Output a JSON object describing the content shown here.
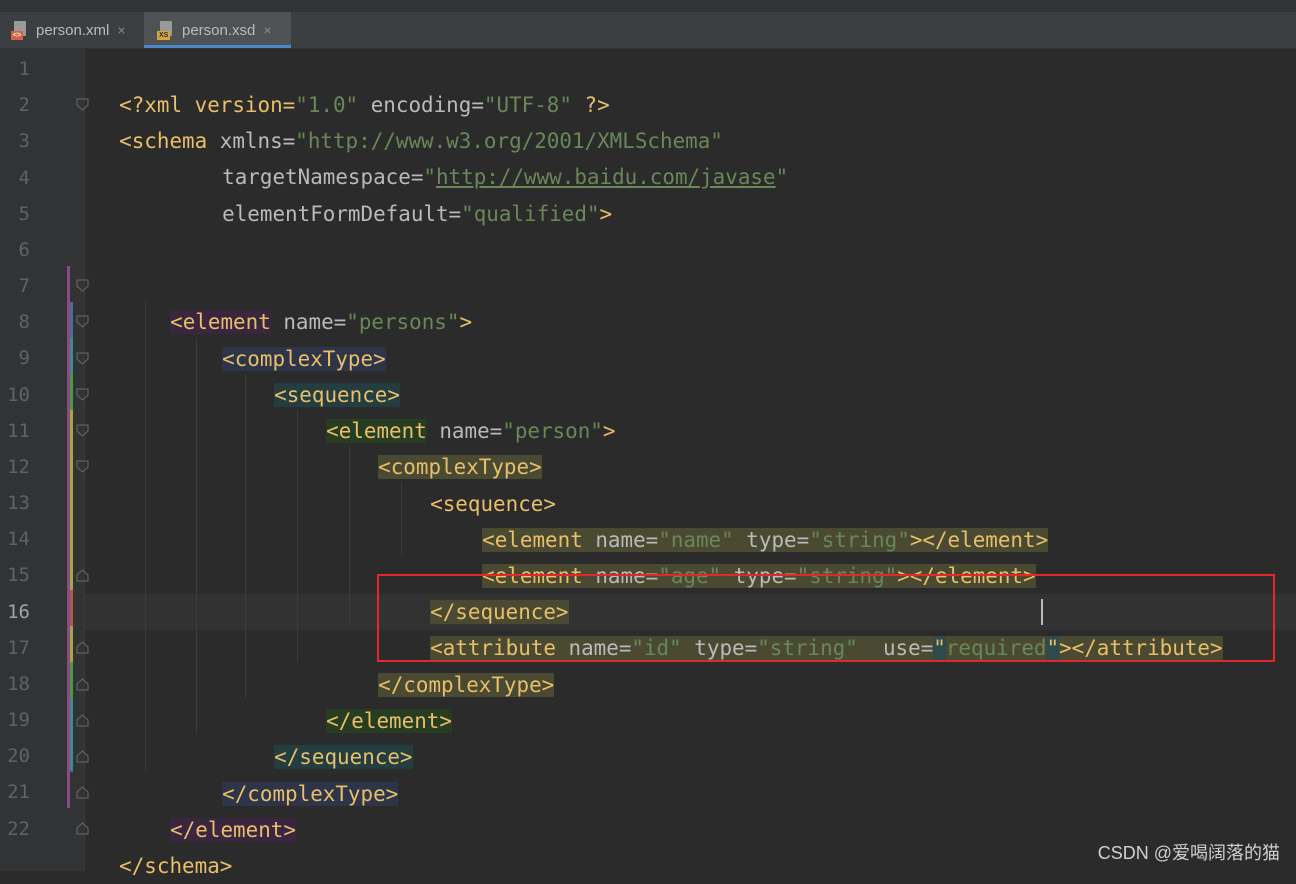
{
  "tabs": [
    {
      "label": "person.xml",
      "icon": "xml-file-icon",
      "badge": "<>",
      "active": false
    },
    {
      "label": "person.xsd",
      "icon": "xsd-file-icon",
      "badge": "XS",
      "active": true
    }
  ],
  "close_glyph": "×",
  "editor": {
    "current_line": 16,
    "line_numbers": [
      "1",
      "2",
      "3",
      "4",
      "5",
      "6",
      "7",
      "8",
      "9",
      "10",
      "11",
      "12",
      "13",
      "14",
      "15",
      "16",
      "17",
      "18",
      "19",
      "20",
      "21",
      "22"
    ],
    "lines": {
      "l1": [
        "<?xml version=",
        "\"1.0\"",
        " encoding=",
        "\"UTF-8\"",
        " ?>"
      ],
      "l2": [
        "<schema",
        " xmlns=",
        "\"http://www.w3.org/2001/XMLSchema\""
      ],
      "l3": [
        "targetNamespace=",
        "\"",
        "http://www.baidu.com/javase",
        "\""
      ],
      "l4": [
        "elementFormDefault=",
        "\"qualified\"",
        ">"
      ],
      "l7": [
        "<element",
        " name=",
        "\"persons\"",
        ">"
      ],
      "l8": [
        "<complexType>"
      ],
      "l9": [
        "<sequence>"
      ],
      "l10": [
        "<element",
        " name=",
        "\"person\"",
        ">"
      ],
      "l11": [
        "<complexType>"
      ],
      "l12": [
        "<sequence>"
      ],
      "l13": [
        "<element",
        " name=",
        "\"name\"",
        " type=",
        "\"string\"",
        "></element>"
      ],
      "l14": [
        "<element",
        " name=",
        "\"age\"",
        " type=",
        "\"string\"",
        "></element>"
      ],
      "l15": [
        "</sequence>"
      ],
      "l16": [
        "<attribute",
        " name=",
        "\"id\"",
        " type=",
        "\"string\"",
        "  use=",
        "\"",
        "required",
        "\"",
        "></attribute>"
      ],
      "l17": [
        "</complexType>"
      ],
      "l18": [
        "</element>"
      ],
      "l19": [
        "</sequence>"
      ],
      "l20": [
        "</complexType>"
      ],
      "l21": [
        "</element>"
      ],
      "l22": [
        "</schema>"
      ]
    }
  },
  "watermark": "CSDN @爱喝阔落的猫",
  "colors": {
    "background": "#2b2b2b",
    "tag": "#e8bf6a",
    "attribute": "#bababa",
    "string": "#6a8759",
    "text": "#a9b7c6",
    "line_number": "#606366",
    "annotation_box": "#e0292d",
    "hl_persons": "#3b2640",
    "hl_complex_outer": "#2e3548",
    "hl_sequence_outer": "#243d40",
    "hl_person": "#273d22",
    "hl_inner": "#4a4a32"
  }
}
